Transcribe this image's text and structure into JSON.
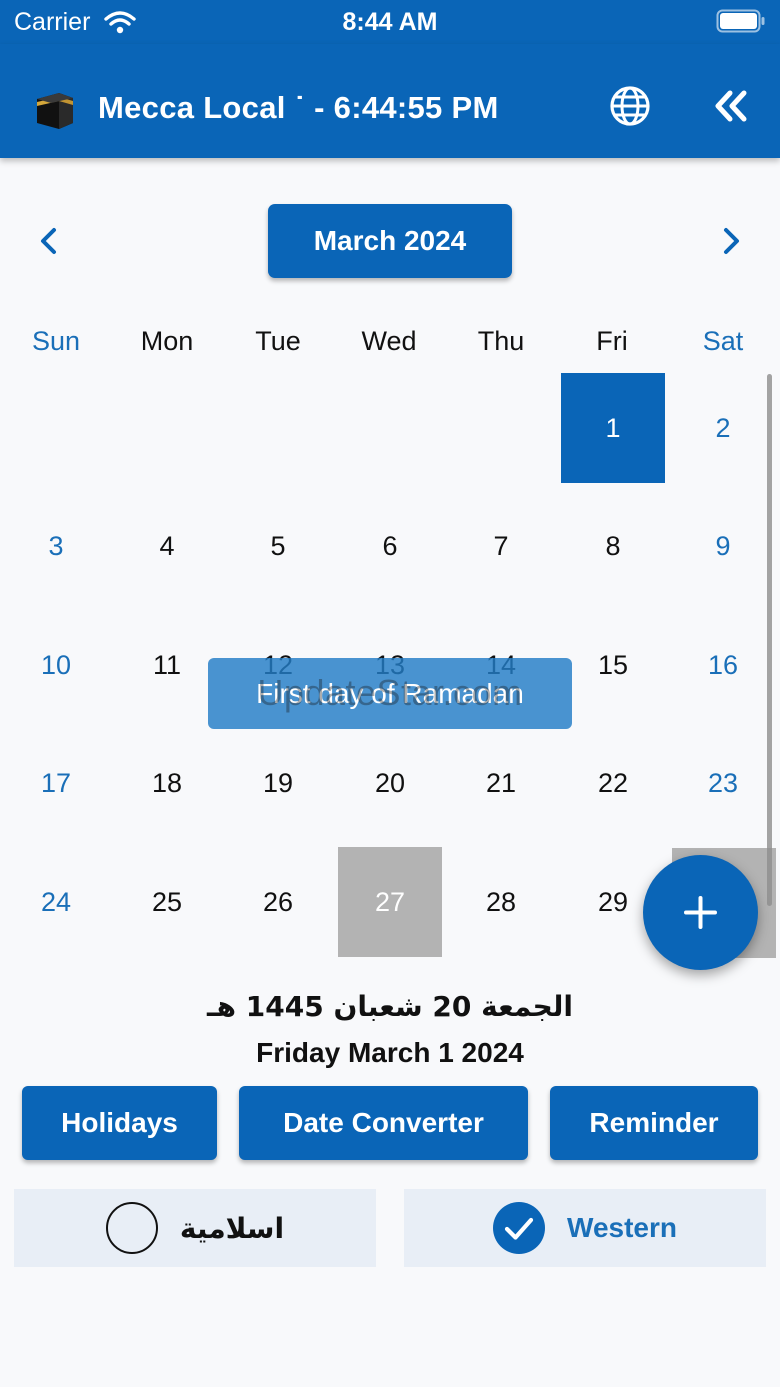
{
  "status_bar": {
    "carrier": "Carrier",
    "time": "8:44 AM"
  },
  "header": {
    "title": "Mecca Local ˙ - 6:44:55 PM"
  },
  "calendar": {
    "month_label": "March 2024",
    "weekdays": [
      "Sun",
      "Mon",
      "Tue",
      "Wed",
      "Thu",
      "Fri",
      "Sat"
    ],
    "weeks": [
      [
        "",
        "",
        "",
        "",
        "",
        "1",
        "2"
      ],
      [
        "3",
        "4",
        "5",
        "6",
        "7",
        "8",
        "9"
      ],
      [
        "10",
        "11",
        "12",
        "13",
        "14",
        "15",
        "16"
      ],
      [
        "17",
        "18",
        "19",
        "20",
        "21",
        "22",
        "23"
      ],
      [
        "24",
        "25",
        "26",
        "27",
        "28",
        "29",
        ""
      ]
    ],
    "selected_day": "1",
    "today_day": "27",
    "event_label": "First day of Ramadan",
    "watermark": "UpdateStar.com"
  },
  "selected_date": {
    "hijri": "الجمعة 20 شعبان 1445 هـ",
    "western": "Friday March 1 2024"
  },
  "actions": {
    "holidays": "Holidays",
    "date_converter": "Date Converter",
    "reminder": "Reminder"
  },
  "calendar_type": {
    "islamic": "اسلامية",
    "western": "Western",
    "selected": "western"
  },
  "colors": {
    "primary": "#0a65b7",
    "weekend": "#1a6fb8",
    "today": "#b3b3b3",
    "option_bg": "#e8eef6"
  }
}
